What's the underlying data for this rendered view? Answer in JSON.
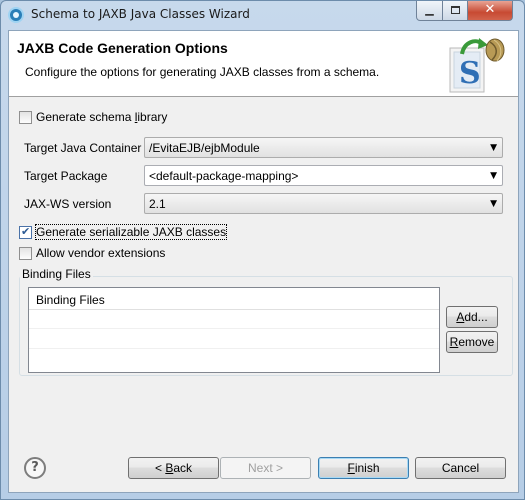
{
  "window": {
    "title": "Schema to JAXB Java Classes Wizard",
    "controls": {
      "minimize": "▁",
      "close": "✕"
    }
  },
  "banner": {
    "title": "JAXB Code Generation Options",
    "description": "Configure the options for generating JAXB classes from a schema.",
    "icon": "wizard-java-class-icon"
  },
  "options": {
    "generate_schema_library": {
      "pre": "Generate schema ",
      "mnemonic": "l",
      "post": "ibrary",
      "checked": false
    },
    "generate_serializable": {
      "label": "Generate serializable JAXB classes",
      "checked": true
    },
    "allow_vendor_extensions": {
      "label": "Allow vendor extensions",
      "checked": false
    }
  },
  "fields": {
    "target_container": {
      "label": "Target Java Container",
      "value": "/EvitaEJB/ejbModule"
    },
    "target_package": {
      "label": "Target Package",
      "value": "<default-package-mapping>"
    },
    "jaxws_version": {
      "label": "JAX-WS version",
      "value": "2.1"
    }
  },
  "binding": {
    "group_label": "Binding Files",
    "column_header": "Binding Files",
    "rows": [],
    "add": {
      "mnemonic": "A",
      "rest": "dd..."
    },
    "remove": {
      "mnemonic": "R",
      "rest": "emove"
    }
  },
  "footer": {
    "back": {
      "pre": "< ",
      "mnemonic": "B",
      "post": "ack"
    },
    "next": "Next >",
    "finish": {
      "mnemonic": "F",
      "rest": "inish"
    },
    "cancel": "Cancel",
    "help": "?"
  }
}
